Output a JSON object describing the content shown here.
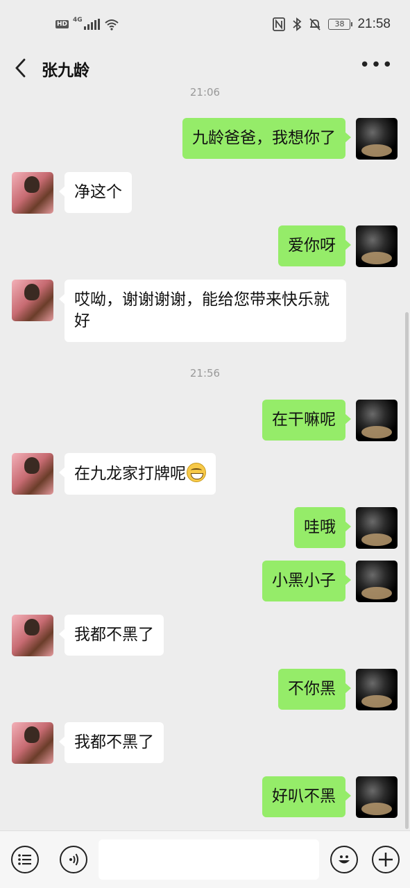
{
  "status_bar": {
    "hd": "HD",
    "network": "4G",
    "battery": "38",
    "time": "21:58"
  },
  "header": {
    "title": "张九龄",
    "more": "•••"
  },
  "timestamps": {
    "first": "21:06",
    "second": "21:56"
  },
  "messages": [
    {
      "side": "right",
      "text": "九龄爸爸，我想你了"
    },
    {
      "side": "left",
      "text": "净这个"
    },
    {
      "side": "right",
      "text": "爱你呀"
    },
    {
      "side": "left",
      "text": "哎呦，谢谢谢谢，能给您带来快乐就好"
    },
    {
      "side": "right",
      "text": "在干嘛呢"
    },
    {
      "side": "left",
      "text": "在九龙家打牌呢",
      "emoji": "grin-emoji"
    },
    {
      "side": "right",
      "text": "哇哦"
    },
    {
      "side": "right",
      "text": "小黑小子"
    },
    {
      "side": "left",
      "text": "我都不黑了"
    },
    {
      "side": "right",
      "text": "不你黑"
    },
    {
      "side": "left",
      "text": "我都不黑了"
    },
    {
      "side": "right",
      "text": "好叭不黑"
    }
  ],
  "input_bar": {
    "value": "",
    "placeholder": ""
  },
  "colors": {
    "background": "#ededed",
    "my_bubble": "#95ec69",
    "other_bubble": "#ffffff"
  }
}
